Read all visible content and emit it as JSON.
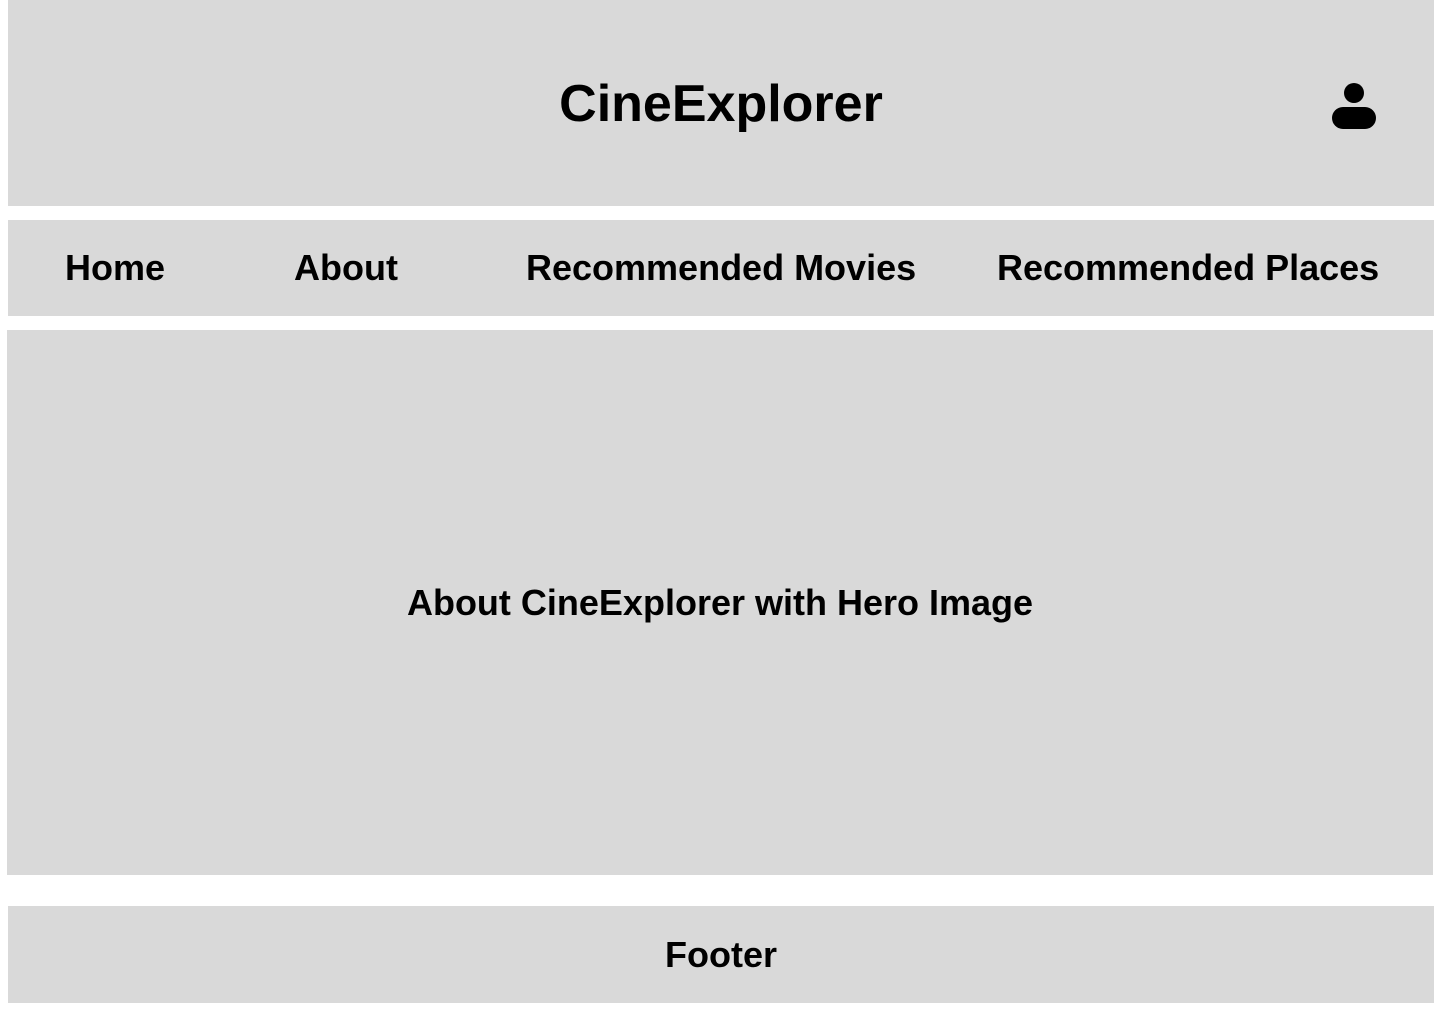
{
  "header": {
    "title": "CineExplorer",
    "user_icon": "user-icon"
  },
  "nav": {
    "items": [
      {
        "label": "Home"
      },
      {
        "label": "About"
      },
      {
        "label": "Recommended Movies"
      },
      {
        "label": "Recommended Places"
      }
    ]
  },
  "hero": {
    "text": "About CineExplorer with Hero Image"
  },
  "footer": {
    "text": "Footer"
  },
  "colors": {
    "block_background": "#d9d9d9",
    "page_background": "#ffffff",
    "text": "#000000"
  }
}
